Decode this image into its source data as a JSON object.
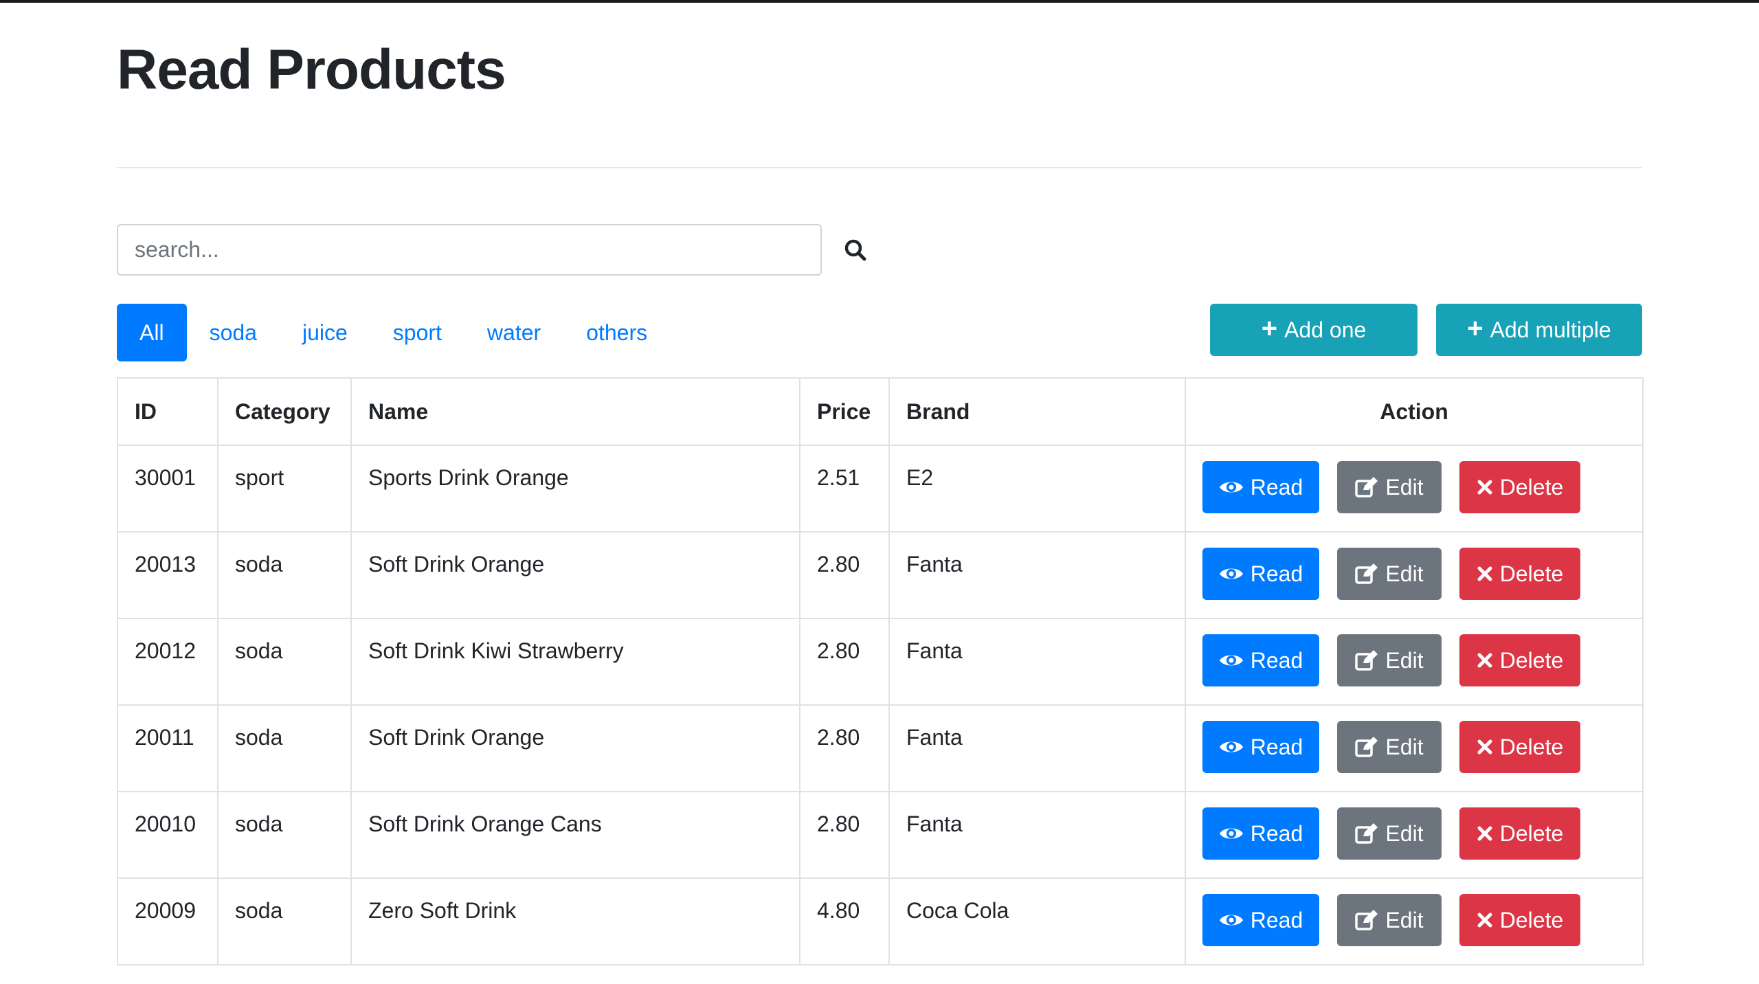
{
  "page": {
    "title": "Read Products"
  },
  "search": {
    "placeholder": "search...",
    "value": "",
    "icon": "search-icon"
  },
  "filters": [
    {
      "label": "All",
      "active": true
    },
    {
      "label": "soda",
      "active": false
    },
    {
      "label": "juice",
      "active": false
    },
    {
      "label": "sport",
      "active": false
    },
    {
      "label": "water",
      "active": false
    },
    {
      "label": "others",
      "active": false
    }
  ],
  "actions": {
    "add_one_label": "Add one",
    "add_multiple_label": "Add multiple",
    "icon": "plus-icon"
  },
  "table": {
    "columns": [
      "ID",
      "Category",
      "Name",
      "Price",
      "Brand",
      "Action"
    ],
    "rows": [
      {
        "id": "30001",
        "category": "sport",
        "name": "Sports Drink Orange",
        "price": "2.51",
        "brand": "E2"
      },
      {
        "id": "20013",
        "category": "soda",
        "name": "Soft Drink Orange",
        "price": "2.80",
        "brand": "Fanta"
      },
      {
        "id": "20012",
        "category": "soda",
        "name": "Soft Drink Kiwi Strawberry",
        "price": "2.80",
        "brand": "Fanta"
      },
      {
        "id": "20011",
        "category": "soda",
        "name": "Soft Drink Orange",
        "price": "2.80",
        "brand": "Fanta"
      },
      {
        "id": "20010",
        "category": "soda",
        "name": "Soft Drink Orange Cans",
        "price": "2.80",
        "brand": "Fanta"
      },
      {
        "id": "20009",
        "category": "soda",
        "name": "Zero Soft Drink",
        "price": "4.80",
        "brand": "Coca Cola"
      }
    ],
    "row_actions": {
      "read": "Read",
      "edit": "Edit",
      "delete": "Delete"
    }
  },
  "colors": {
    "primary": "#007bff",
    "info": "#17a2b8",
    "secondary": "#6c757d",
    "danger": "#dc3545",
    "text": "#212529"
  }
}
